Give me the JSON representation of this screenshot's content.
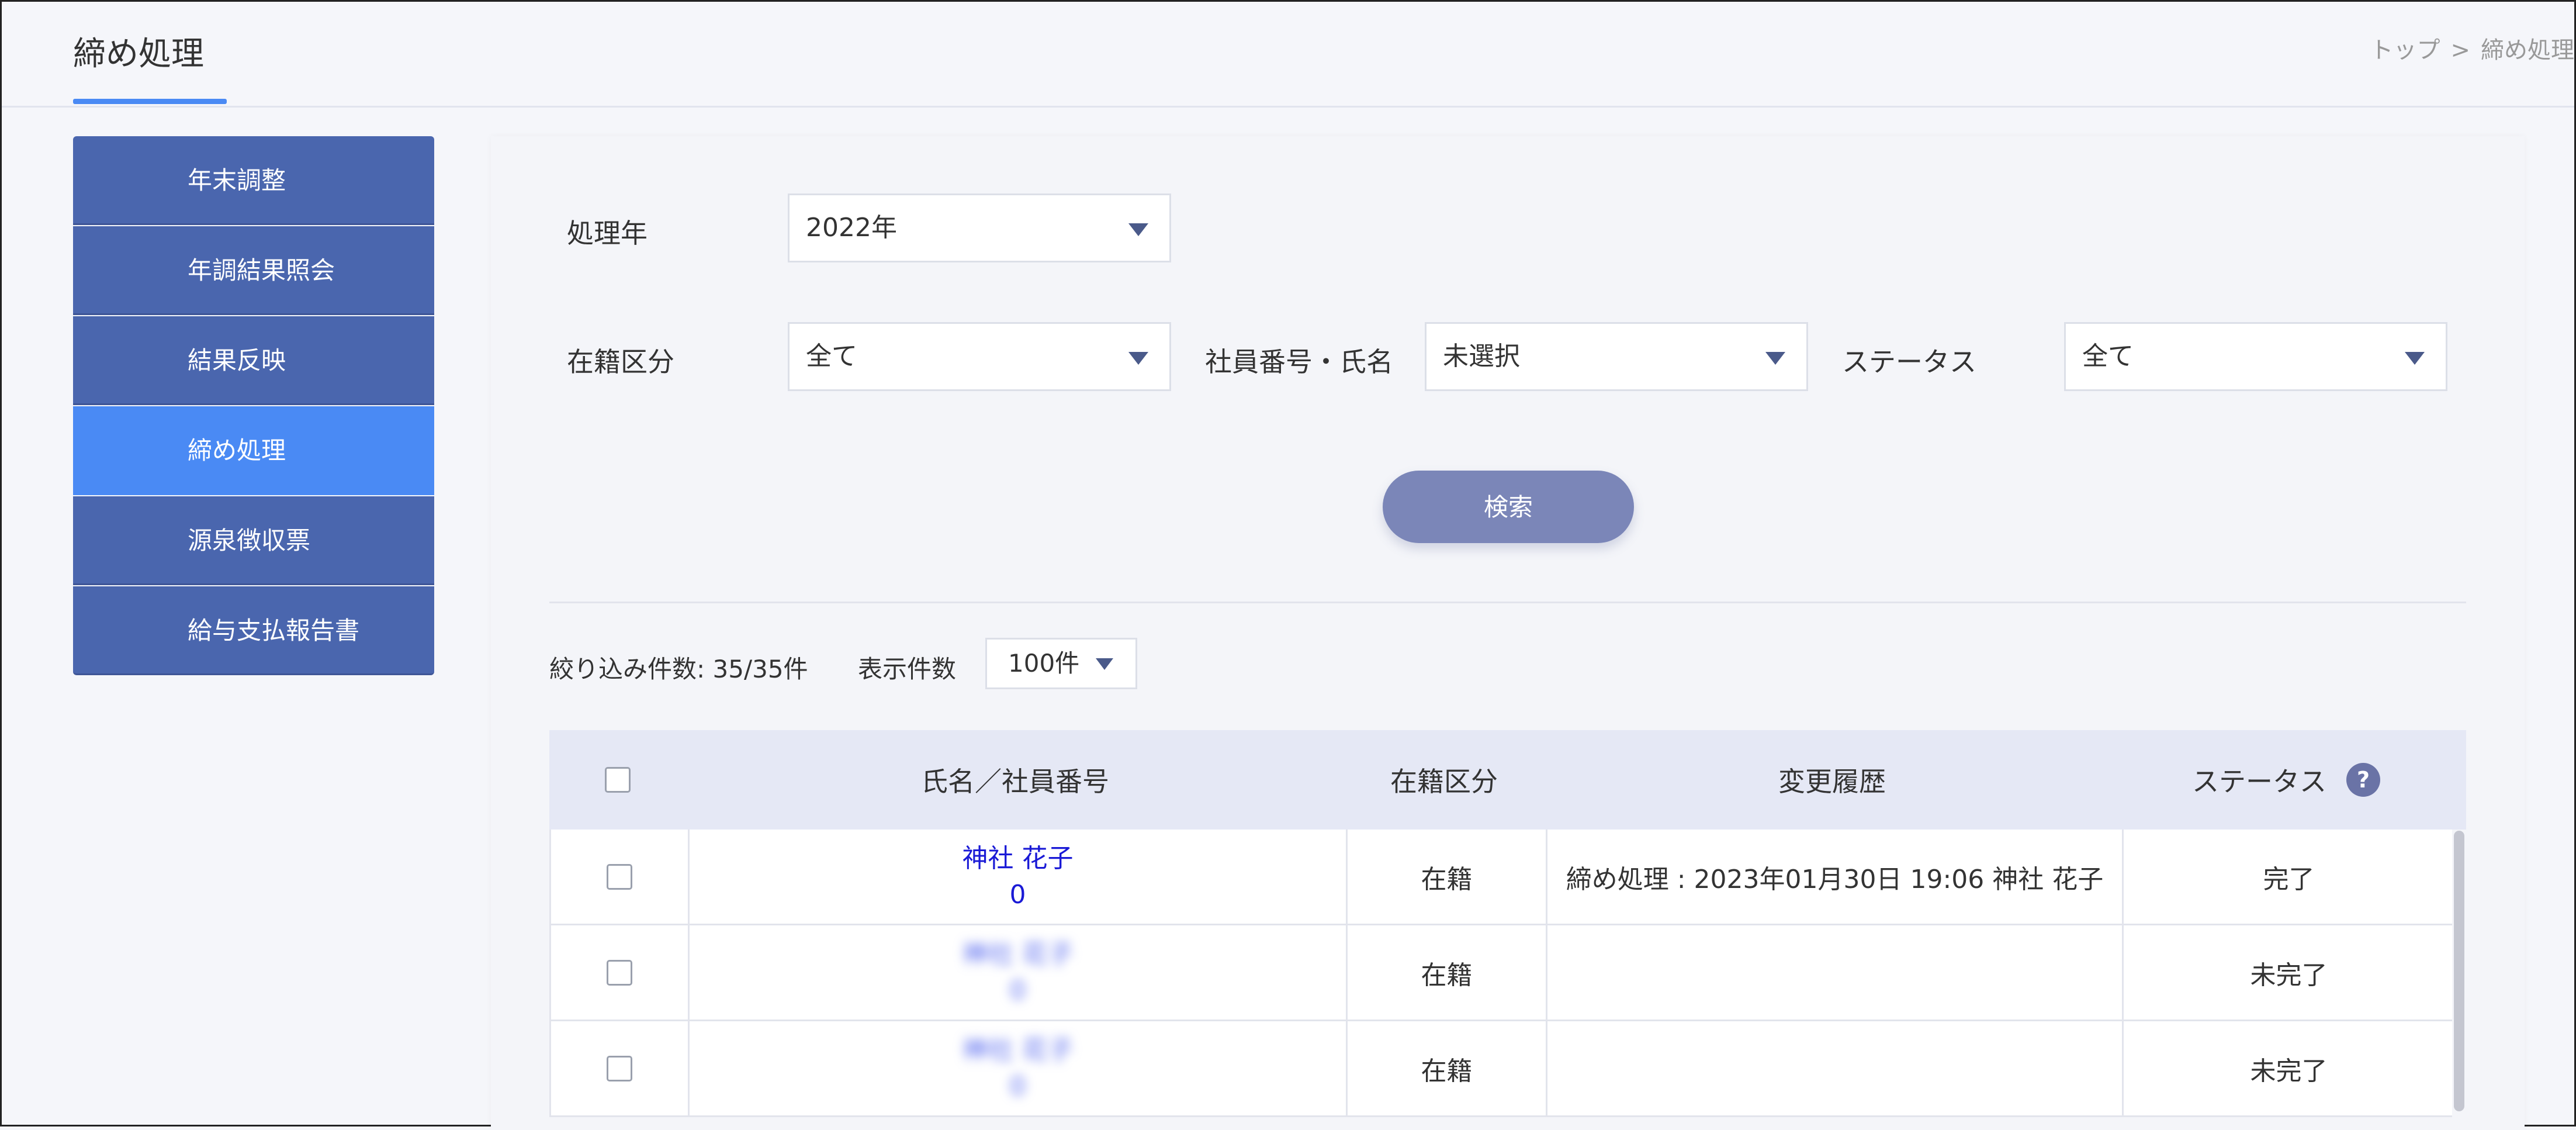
{
  "header": {
    "title": "締め処理",
    "breadcrumb": [
      "トップ",
      "締め処理"
    ],
    "breadcrumb_sep": ">"
  },
  "sidebar": {
    "items": [
      {
        "label": "年末調整"
      },
      {
        "label": "年調結果照会"
      },
      {
        "label": "結果反映"
      },
      {
        "label": "締め処理",
        "active": true
      },
      {
        "label": "源泉徴収票"
      },
      {
        "label": "給与支払報告書"
      }
    ]
  },
  "filters": {
    "year_label": "処理年",
    "year_value": "2022年",
    "enroll_label": "在籍区分",
    "enroll_value": "全て",
    "emp_label": "社員番号・氏名",
    "emp_value": "未選択",
    "status_label": "ステータス",
    "status_value": "全て",
    "search_label": "検索"
  },
  "results": {
    "count_text": "絞り込み件数: 35/35件",
    "display_label": "表示件数",
    "display_value": "100件"
  },
  "table": {
    "headers": {
      "name": "氏名／社員番号",
      "enroll": "在籍区分",
      "history": "変更履歴",
      "status": "ステータス",
      "help": "?"
    },
    "rows": [
      {
        "name": "神社 花子",
        "number": "0",
        "enroll": "在籍",
        "history": "締め処理 : 2023年01月30日 19:06 神社 花子",
        "status": "完了"
      },
      {
        "name": "神社 花子",
        "number": "0",
        "enroll": "在籍",
        "history": "",
        "status": "未完了"
      },
      {
        "name": "神社 花子",
        "number": "0",
        "enroll": "在籍",
        "history": "",
        "status": "未完了"
      }
    ]
  },
  "colors": {
    "sidebar_bg": "#4a66ae",
    "sidebar_active": "#4a8af4",
    "search_button": "#7b86b8",
    "link": "#1a1ad6"
  }
}
